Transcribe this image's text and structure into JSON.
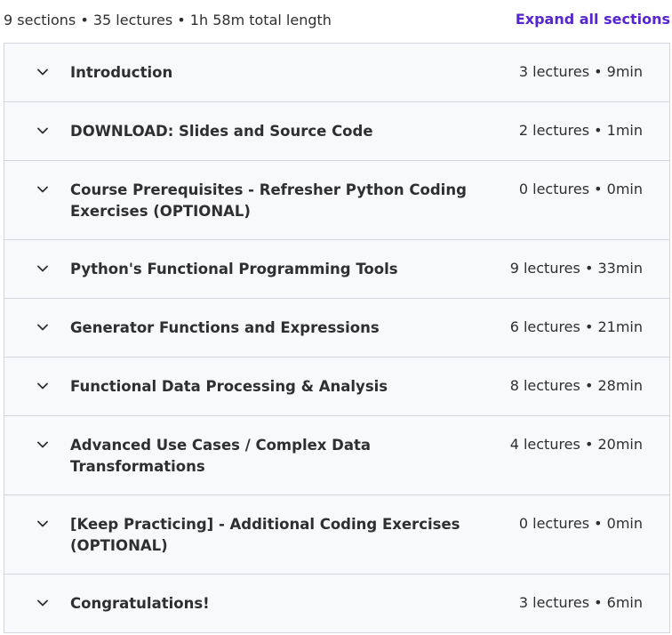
{
  "curriculum": {
    "summary": "9 sections • 35 lectures • 1h 58m total length",
    "expand_all_label": "Expand all sections",
    "accent_color": "#5624d0",
    "sections": [
      {
        "title": "Introduction",
        "meta": "3 lectures • 9min",
        "icon": "chevron-down-icon"
      },
      {
        "title": "DOWNLOAD: Slides and Source Code",
        "meta": "2 lectures • 1min",
        "icon": "chevron-down-icon"
      },
      {
        "title": "Course Prerequisites - Refresher Python Coding Exercises (OPTIONAL)",
        "meta": "0 lectures • 0min",
        "icon": "chevron-down-icon"
      },
      {
        "title": "Python's Functional Programming Tools",
        "meta": "9 lectures • 33min",
        "icon": "chevron-down-icon"
      },
      {
        "title": "Generator Functions and Expressions",
        "meta": "6 lectures • 21min",
        "icon": "chevron-down-icon"
      },
      {
        "title": "Functional Data Processing & Analysis",
        "meta": "8 lectures • 28min",
        "icon": "chevron-down-icon"
      },
      {
        "title": "Advanced Use Cases / Complex Data Transformations",
        "meta": "4 lectures • 20min",
        "icon": "chevron-down-icon"
      },
      {
        "title": "[Keep Practicing] - Additional Coding Exercises (OPTIONAL)",
        "meta": "0 lectures • 0min",
        "icon": "chevron-down-icon"
      },
      {
        "title": "Congratulations!",
        "meta": "3 lectures • 6min",
        "icon": "chevron-down-icon"
      }
    ]
  }
}
